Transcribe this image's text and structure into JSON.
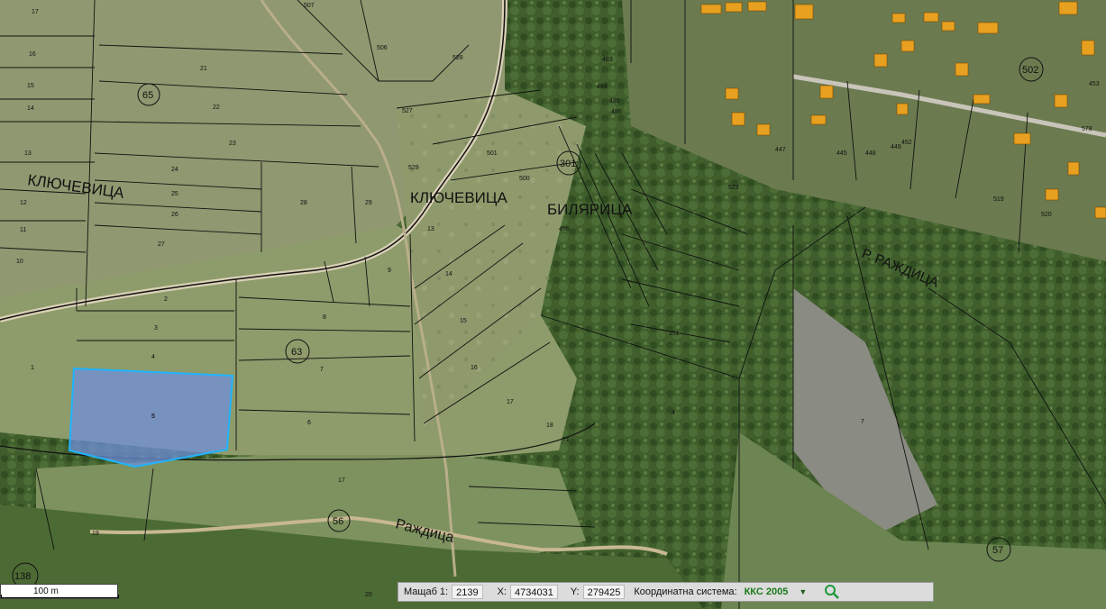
{
  "map": {
    "place_labels": [
      "КЛЮЧЕВИЦА",
      "КЛЮЧЕВИЦА",
      "БИЛЯРИЦА",
      "Р. РАЖДИЦА",
      "Раждица"
    ],
    "district_numbers": [
      "65",
      "63",
      "301",
      "502",
      "56",
      "57",
      "138"
    ],
    "parcel_numbers": [
      "17",
      "16",
      "15",
      "14",
      "13",
      "12",
      "11",
      "10",
      "9",
      "21",
      "22",
      "23",
      "24",
      "25",
      "26",
      "27",
      "28",
      "29",
      "2",
      "3",
      "4",
      "5",
      "6",
      "7",
      "8",
      "1",
      "507",
      "506",
      "528",
      "527",
      "529",
      "501",
      "500",
      "483",
      "484",
      "485",
      "486",
      "496",
      "13",
      "14",
      "15",
      "16",
      "17",
      "18",
      "21",
      "17",
      "19",
      "20",
      "445",
      "447",
      "448",
      "449",
      "452",
      "523",
      "519",
      "520",
      "578",
      "453",
      "151",
      "4",
      "7"
    ],
    "selected_parcel": "5"
  },
  "scale": {
    "label": "100 m"
  },
  "status": {
    "scale_label": "Мащаб 1:",
    "scale_value": "2139",
    "x_label": "X:",
    "x_value": "4734031",
    "y_label": "Y:",
    "y_value": "279425",
    "crs_label": "Координатна система:",
    "crs_value": "ККС 2005"
  },
  "colors": {
    "selection_fill": "#6f8fd9",
    "selection_stroke": "#1fb4ff",
    "building": "#e8a020",
    "statusbar_bg": "#dcdcdc",
    "crs_text": "#1b7a1b"
  },
  "icons": {
    "dropdown": "triangle-down-icon",
    "search": "magnifier-icon"
  }
}
